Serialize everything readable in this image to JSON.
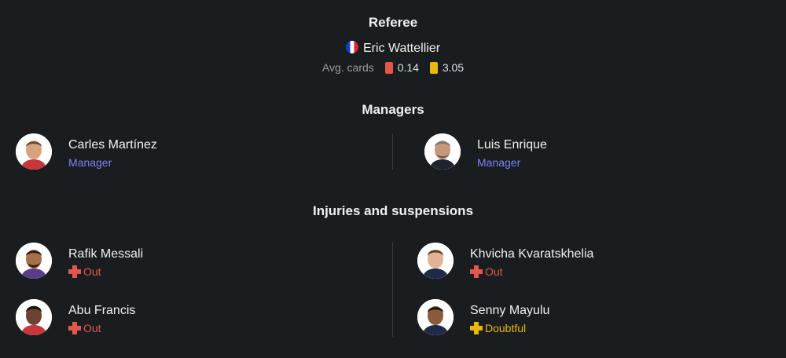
{
  "referee": {
    "title": "Referee",
    "name": "Eric Wattellier",
    "flag_icon": "france-flag-icon",
    "avg_cards_label": "Avg. cards",
    "red_avg": "0.14",
    "yellow_avg": "3.05"
  },
  "managers": {
    "title": "Managers",
    "home": {
      "name": "Carles Martínez",
      "role": "Manager"
    },
    "away": {
      "name": "Luis Enrique",
      "role": "Manager"
    }
  },
  "injuries": {
    "title": "Injuries and suspensions",
    "home": [
      {
        "name": "Rafik Messali",
        "status": "Out"
      },
      {
        "name": "Abu Francis",
        "status": "Out"
      }
    ],
    "away": [
      {
        "name": "Khvicha Kvaratskhelia",
        "status": "Out"
      },
      {
        "name": "Senny Mayulu",
        "status": "Doubtful"
      }
    ]
  },
  "colors": {
    "background": "#1a1d1f",
    "manager_role": "#7b82f5",
    "out": "#e2574c",
    "doubtful": "#e8b80f",
    "red_card": "#e2574c",
    "yellow_card": "#e8b80f"
  }
}
